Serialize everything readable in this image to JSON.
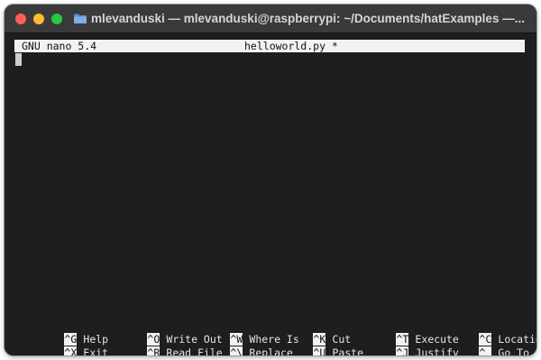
{
  "window": {
    "title": "mlevanduski — mlevanduski@raspberrypi: ~/Documents/hatExamples —..."
  },
  "icons": {
    "close": "close-traffic-light",
    "minimize": "minimize-traffic-light",
    "maximize": "maximize-traffic-light",
    "folder": "folder-icon"
  },
  "colors": {
    "close": "#ff5f57",
    "minimize": "#febc2e",
    "maximize": "#28c840",
    "terminal_bg": "#1e1e1e",
    "titlebar_bg": "#3a3a3a",
    "inverse_bg": "#f2f2f2"
  },
  "nano": {
    "version": "GNU nano 5.4",
    "filename": "helloworld.py *"
  },
  "shortcuts": {
    "row1": [
      {
        "key": "^G",
        "label": "Help"
      },
      {
        "key": "^O",
        "label": "Write Out"
      },
      {
        "key": "^W",
        "label": "Where Is"
      },
      {
        "key": "^K",
        "label": "Cut"
      },
      {
        "key": "^T",
        "label": "Execute"
      },
      {
        "key": "^C",
        "label": "Location"
      }
    ],
    "row2": [
      {
        "key": "^X",
        "label": "Exit"
      },
      {
        "key": "^R",
        "label": "Read File"
      },
      {
        "key": "^\\",
        "label": "Replace"
      },
      {
        "key": "^U",
        "label": "Paste"
      },
      {
        "key": "^J",
        "label": "Justify"
      },
      {
        "key": "^_",
        "label": "Go To Line"
      }
    ]
  }
}
